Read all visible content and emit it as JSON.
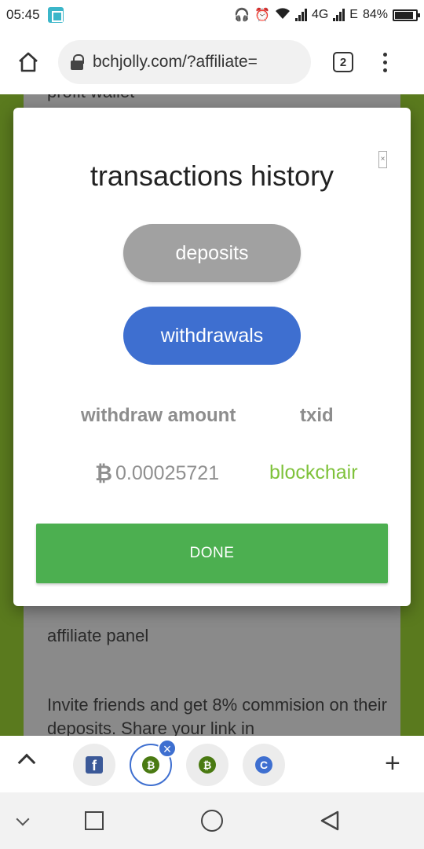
{
  "status_bar": {
    "time": "05:45",
    "network": "4G",
    "network2": "E",
    "battery": "84%"
  },
  "browser": {
    "url": "bchjolly.com/?affiliate=",
    "tab_count": "2"
  },
  "page": {
    "top_text": "profit wallet",
    "affiliate_heading": "affiliate panel",
    "affiliate_text": "Invite friends and get 8% commision on their deposits. Share your link in"
  },
  "modal": {
    "title": "transactions history",
    "close_icon": "close-icon",
    "deposits_label": "deposits",
    "withdrawals_label": "withdrawals",
    "columns": [
      "withdraw amount",
      "txid"
    ],
    "rows": [
      {
        "amount": "0.00025721",
        "currency_symbol": "₿",
        "txid_label": "blockchair"
      }
    ],
    "done_label": "DONE",
    "colors": {
      "withdrawals_active": "#3e6fd0",
      "deposits_inactive": "#a1a1a1",
      "done_button": "#4caf50",
      "txid_link": "#7fc23b"
    }
  },
  "tab_strip": {
    "tabs": [
      {
        "icon": "facebook-icon",
        "glyph": "f"
      },
      {
        "icon": "bitcoin-icon",
        "glyph": "₿",
        "active": true
      },
      {
        "icon": "bitcoin-icon",
        "glyph": "₿"
      },
      {
        "icon": "c-icon",
        "glyph": "C"
      }
    ],
    "close_glyph": "×",
    "plus_glyph": "+"
  }
}
